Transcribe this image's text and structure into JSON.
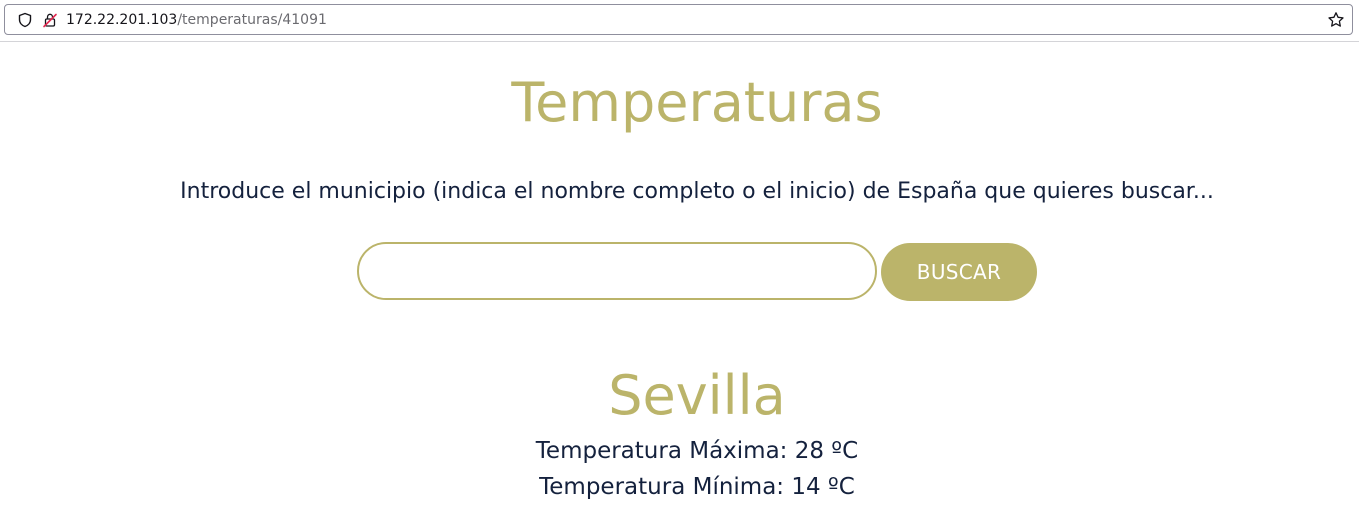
{
  "browser": {
    "url_host": "172.22.201.103",
    "url_path": "/temperaturas/41091",
    "icons": {
      "left": "shield-icon",
      "security": "lock-insecure-icon",
      "right": "bookmark-star-icon"
    }
  },
  "page": {
    "title": "Temperaturas",
    "instructions": "Introduce el municipio (indica el nombre completo o el inicio) de España que quieres buscar...",
    "search": {
      "value": "",
      "placeholder": "",
      "button_label": "BUSCAR"
    },
    "result": {
      "city": "Sevilla",
      "max_line": "Temperatura Máxima: 28 ºC",
      "min_line": "Temperatura Mínima: 14 ºC"
    }
  },
  "colors": {
    "accent": "#bbb46a",
    "text": "#14213d",
    "background": "#ffffff"
  }
}
